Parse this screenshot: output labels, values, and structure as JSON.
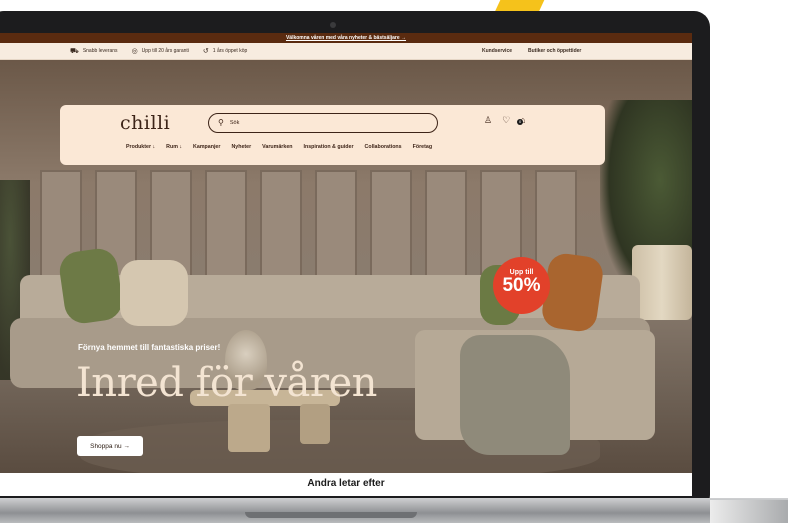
{
  "announcement": {
    "text": "Välkomna våren med våra nyheter & bästsäljare →"
  },
  "infobar": {
    "left": [
      {
        "icon": "truck-icon",
        "label": "Snabb leverans"
      },
      {
        "icon": "badge-icon",
        "label": "Upp till 20 års garanti"
      },
      {
        "icon": "return-icon",
        "label": "1 års öppet köp"
      }
    ],
    "right": [
      "Kundservice",
      "Butiker och öppettider"
    ]
  },
  "header": {
    "logo": "chilli",
    "search_placeholder": "Sök",
    "menu": [
      "Produkter ↓",
      "Rum ↓",
      "Kampanjer",
      "Nyheter",
      "Varumärken",
      "Inspiration & guider",
      "Collaborations",
      "Företag"
    ],
    "cart_count": "0"
  },
  "hero": {
    "promo_line1": "Upp till",
    "promo_line2": "50%",
    "subtitle": "Förnya hemmet till fantastiska priser!",
    "title": "Inred för våren",
    "cta": "Shoppa nu →"
  },
  "section": {
    "title": "Andra letar efter"
  },
  "colors": {
    "announce": "#5a2b10",
    "nav_bg": "#fbe8d6",
    "promo": "#e2412a",
    "brand": "#3d2418"
  }
}
